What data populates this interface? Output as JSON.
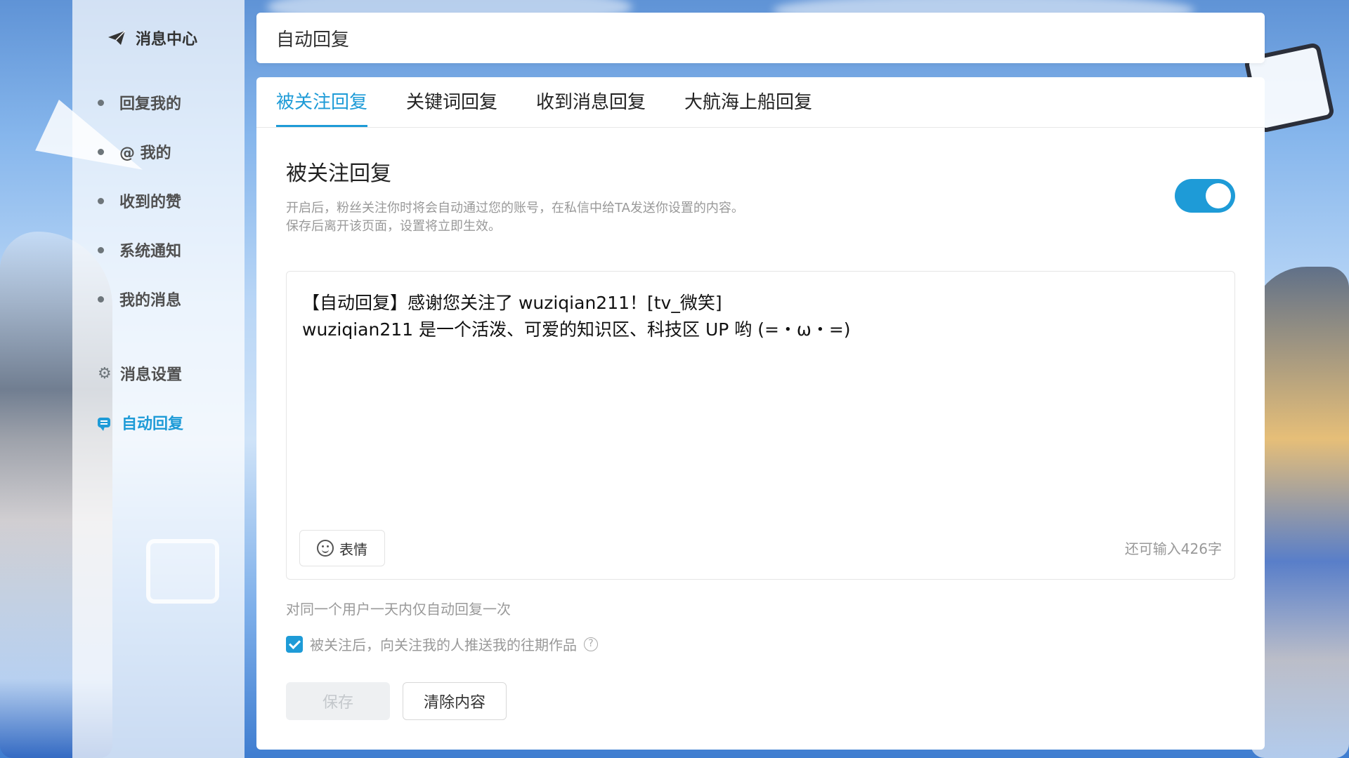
{
  "sidebar": {
    "title": "消息中心",
    "title_icon": "paper-plane-icon",
    "items": [
      {
        "label": "回复我的"
      },
      {
        "label": "@ 我的"
      },
      {
        "label": "收到的赞"
      },
      {
        "label": "系统通知"
      },
      {
        "label": "我的消息"
      }
    ],
    "settings": {
      "label": "消息设置",
      "icon": "gear-icon"
    },
    "auto_reply": {
      "label": "自动回复",
      "icon": "chat-bubble-icon"
    }
  },
  "header": {
    "title": "自动回复"
  },
  "tabs": [
    {
      "label": "被关注回复",
      "active": true
    },
    {
      "label": "关键词回复"
    },
    {
      "label": "收到消息回复"
    },
    {
      "label": "大航海上船回复"
    }
  ],
  "section": {
    "title": "被关注回复",
    "desc_line1": "开启后，粉丝关注你时将会自动通过您的账号，在私信中给TA发送你设置的内容。",
    "desc_line2": "保存后离开该页面，设置将立即生效。",
    "toggle_on": true
  },
  "editor": {
    "content": "【自动回复】感谢您关注了 wuziqian211！[tv_微笑]\nwuziqian211 是一个活泼、可爱的知识区、科技区 UP 哟 (=・ω・=)",
    "emoji_label": "表情",
    "remaining": "还可输入426字"
  },
  "note": "对同一个用户一天内仅自动回复一次",
  "checkbox": {
    "label": "被关注后，向关注我的人推送我的往期作品",
    "checked": true,
    "help": "?"
  },
  "buttons": {
    "save": "保存",
    "clear": "清除内容"
  },
  "colors": {
    "accent": "#1e9bd7",
    "text": "#222222",
    "muted": "#999999"
  }
}
